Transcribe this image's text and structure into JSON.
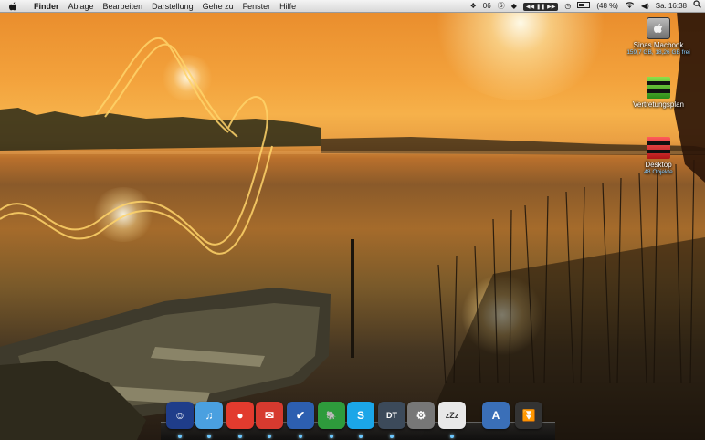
{
  "menubar": {
    "apple_icon": "apple-logo-icon",
    "app_name": "Finder",
    "menus": [
      "Ablage",
      "Bearbeiten",
      "Darstellung",
      "Gehe zu",
      "Fenster",
      "Hilfe"
    ],
    "status": {
      "badge_06": "06",
      "battery_percent": "(48 %)",
      "battery_level": 0.48,
      "clock": "Sa. 16:38"
    }
  },
  "desktop": {
    "icons": [
      {
        "label": "Sinas Macbook",
        "sub": "159,7 GB, 18,26 GB frei",
        "icon": "hard-drive-icon"
      },
      {
        "label": "Vertretungsplan",
        "icon": "green-folder-icon"
      },
      {
        "label": "Desktop",
        "sub": "48 Objekte",
        "icon": "red-folder-icon"
      }
    ]
  },
  "dock": {
    "items": [
      {
        "name": "finder",
        "icon": "finder-icon",
        "glyph": "☺",
        "color": "#1f3d8a"
      },
      {
        "name": "itunes",
        "icon": "itunes-icon",
        "glyph": "♫",
        "color": "#4aa0e0"
      },
      {
        "name": "chrome",
        "icon": "chrome-icon",
        "glyph": "●",
        "color": "#e23b2e"
      },
      {
        "name": "mail",
        "icon": "mail-icon",
        "glyph": "✉",
        "color": "#d63a2f"
      },
      {
        "name": "tasks",
        "icon": "checkbox-app-icon",
        "glyph": "✔",
        "color": "#2d5fb0"
      },
      {
        "name": "evernote",
        "icon": "evernote-icon",
        "glyph": "🐘",
        "color": "#2e9b3c"
      },
      {
        "name": "skype",
        "icon": "skype-icon",
        "glyph": "S",
        "color": "#1ba6e8"
      },
      {
        "name": "devontech",
        "icon": "dt-icon",
        "glyph": "DT",
        "color": "#3c4a5a"
      },
      {
        "name": "system-prefs",
        "icon": "system-preferences-icon",
        "glyph": "⚙",
        "color": "#777777"
      },
      {
        "name": "growl",
        "icon": "zzz-chat-icon",
        "glyph": "zZz",
        "color": "#e8e8e8"
      },
      {
        "name": "applications",
        "icon": "applications-folder-icon",
        "glyph": "A",
        "color": "#3a6fb8"
      },
      {
        "name": "downloads",
        "icon": "downloads-stack-icon",
        "glyph": "⏬",
        "color": "#333333"
      }
    ]
  }
}
